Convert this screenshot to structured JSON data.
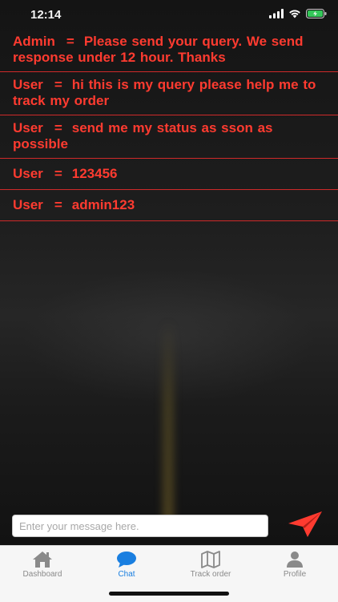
{
  "status_bar": {
    "time": "12:14"
  },
  "messages": [
    {
      "sender": "Admin",
      "separator": "=",
      "text": "Please send your query. We send response under 12 hour. Thanks"
    },
    {
      "sender": "User",
      "separator": "=",
      "text": "hi this is my query please help me to track my order"
    },
    {
      "sender": "User",
      "separator": "=",
      "text": "send me my status as sson as possible"
    },
    {
      "sender": "User",
      "separator": "=",
      "text": "123456"
    },
    {
      "sender": "User",
      "separator": "=",
      "text": "admin123"
    }
  ],
  "composer": {
    "placeholder": "Enter your message here.",
    "value": ""
  },
  "tabs": [
    {
      "label": "Dashboard",
      "icon": "home-icon",
      "active": false
    },
    {
      "label": "Chat",
      "icon": "chat-icon",
      "active": true
    },
    {
      "label": "Track order",
      "icon": "map-icon",
      "active": false
    },
    {
      "label": "Profile",
      "icon": "person-icon",
      "active": false
    }
  ],
  "colors": {
    "message_text": "#ff3b30",
    "divider": "#cf2a2a",
    "active_tab": "#1a7fe0",
    "inactive_tab": "#8a8a8a",
    "send_icon": "#ff3b30"
  }
}
